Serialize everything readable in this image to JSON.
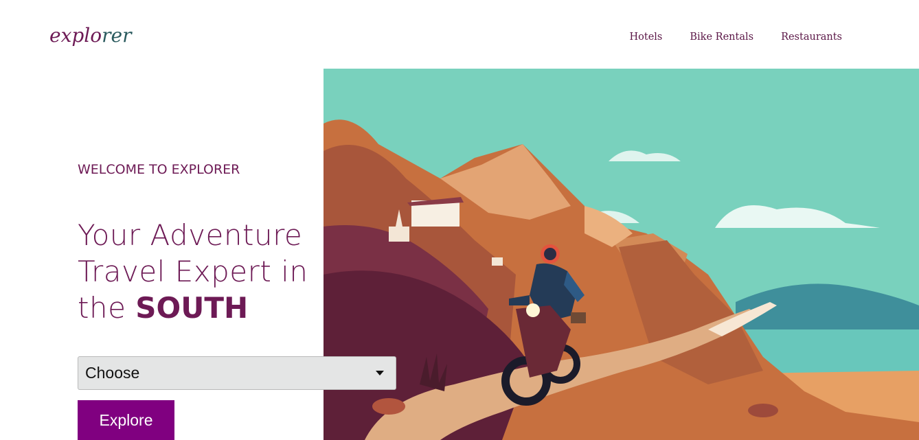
{
  "header": {
    "logo_part1": "explo",
    "logo_part2": "rer",
    "nav": [
      {
        "label": "Hotels"
      },
      {
        "label": "Bike Rentals"
      },
      {
        "label": "Restaurants"
      }
    ]
  },
  "hero": {
    "kicker": "WELCOME TO EXPLORER",
    "headline_main": "Your Adventure Travel Expert in the ",
    "headline_accent": "SOUTH",
    "select": {
      "selected": "Choose"
    },
    "button_label": "Explore",
    "image_alt": "Illustration of a motorcyclist riding a winding mountain road"
  },
  "colors": {
    "brand": "#6d1a55",
    "button": "#800080",
    "sky": "#79d1bd"
  }
}
